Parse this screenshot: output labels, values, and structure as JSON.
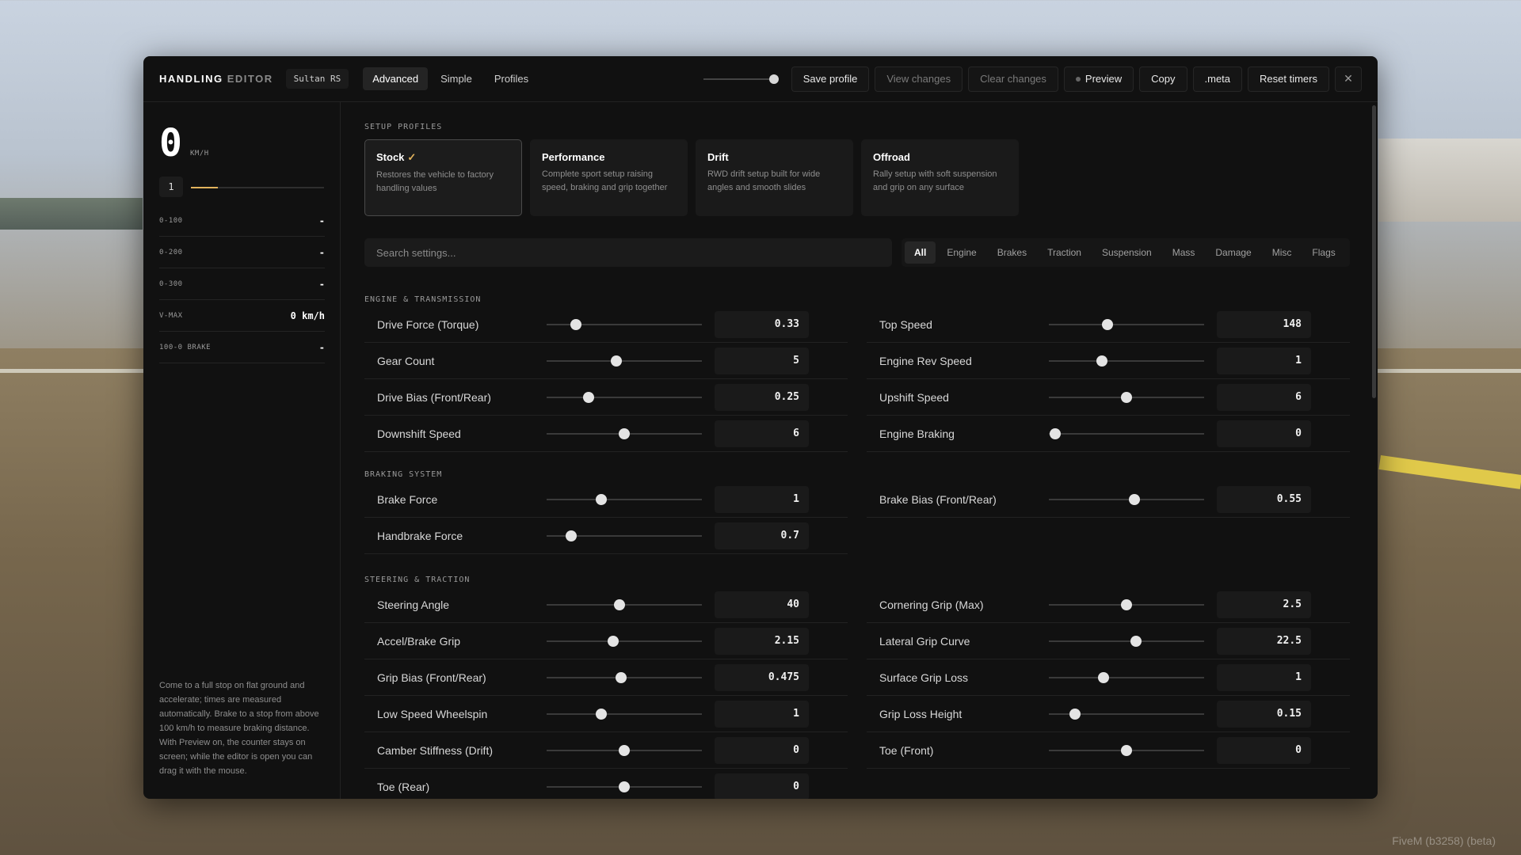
{
  "header": {
    "brand_primary": "HANDLING",
    "brand_secondary": "EDITOR",
    "vehicle": "Sultan RS",
    "mode_tabs": [
      "Advanced",
      "Simple",
      "Profiles"
    ],
    "buttons": {
      "save_profile": "Save profile",
      "view_changes": "View changes",
      "clear_changes": "Clear changes",
      "preview": "Preview",
      "copy": "Copy",
      "meta": ".meta",
      "reset_timers": "Reset timers"
    },
    "opacity_level": 1.0
  },
  "sidebar": {
    "speed": "0",
    "speed_unit": "KM/H",
    "gear": "1",
    "rpm_fraction": 0.2,
    "stats": [
      {
        "label": "0-100",
        "value": "-"
      },
      {
        "label": "0-200",
        "value": "-"
      },
      {
        "label": "0-300",
        "value": "-"
      },
      {
        "label": "V-MAX",
        "value": "0 km/h"
      },
      {
        "label": "100-0 BRAKE",
        "value": "-"
      }
    ],
    "note": "Come to a full stop on flat ground and accelerate; times are measured automatically. Brake to a stop from above 100 km/h to measure braking distance. With Preview on, the counter stays on screen; while the editor is open you can drag it with the mouse."
  },
  "profiles": {
    "title": "SETUP PROFILES",
    "cards": [
      {
        "name": "Stock",
        "check": "✓",
        "desc": "Restores the vehicle to factory handling values"
      },
      {
        "name": "Performance",
        "check": "",
        "desc": "Complete sport setup raising speed, braking and grip together"
      },
      {
        "name": "Drift",
        "check": "",
        "desc": "RWD drift setup built for wide angles and smooth slides"
      },
      {
        "name": "Offroad",
        "check": "",
        "desc": "Rally setup with soft suspension and grip on any surface"
      }
    ]
  },
  "search": {
    "placeholder": "Search settings..."
  },
  "filters": [
    "All",
    "Engine",
    "Brakes",
    "Traction",
    "Suspension",
    "Mass",
    "Damage",
    "Misc",
    "Flags"
  ],
  "sections": {
    "engine": {
      "title": "ENGINE & TRANSMISSION",
      "rows": [
        {
          "label": "Drive Force (Torque)",
          "value": "0.33",
          "level": 0.19
        },
        {
          "label": "Top Speed",
          "value": "148",
          "level": 0.38
        },
        {
          "label": "Gear Count",
          "value": "5",
          "level": 0.45
        },
        {
          "label": "Engine Rev Speed",
          "value": "1",
          "level": 0.34
        },
        {
          "label": "Drive Bias (Front/Rear)",
          "value": "0.25",
          "level": 0.27
        },
        {
          "label": "Upshift Speed",
          "value": "6",
          "level": 0.5
        },
        {
          "label": "Downshift Speed",
          "value": "6",
          "level": 0.5
        },
        {
          "label": "Engine Braking",
          "value": "0",
          "level": 0.04
        }
      ]
    },
    "braking": {
      "title": "BRAKING SYSTEM",
      "rows": [
        {
          "label": "Brake Force",
          "value": "1",
          "level": 0.35
        },
        {
          "label": "Brake Bias (Front/Rear)",
          "value": "0.55",
          "level": 0.55
        },
        {
          "label": "Handbrake Force",
          "value": "0.7",
          "level": 0.16
        }
      ]
    },
    "steering": {
      "title": "STEERING & TRACTION",
      "rows": [
        {
          "label": "Steering Angle",
          "value": "40",
          "level": 0.47
        },
        {
          "label": "Cornering Grip (Max)",
          "value": "2.5",
          "level": 0.5
        },
        {
          "label": "Accel/Brake Grip",
          "value": "2.15",
          "level": 0.43
        },
        {
          "label": "Lateral Grip Curve",
          "value": "22.5",
          "level": 0.56
        },
        {
          "label": "Grip Bias (Front/Rear)",
          "value": "0.475",
          "level": 0.48
        },
        {
          "label": "Surface Grip Loss",
          "value": "1",
          "level": 0.35
        },
        {
          "label": "Low Speed Wheelspin",
          "value": "1",
          "level": 0.35
        },
        {
          "label": "Grip Loss Height",
          "value": "0.15",
          "level": 0.17
        },
        {
          "label": "Camber Stiffness (Drift)",
          "value": "0",
          "level": 0.5
        },
        {
          "label": "Toe (Front)",
          "value": "0",
          "level": 0.5
        },
        {
          "label": "Toe (Rear)",
          "value": "0",
          "level": 0.5
        }
      ]
    }
  },
  "watermark": "FiveM (b3258) (beta)"
}
